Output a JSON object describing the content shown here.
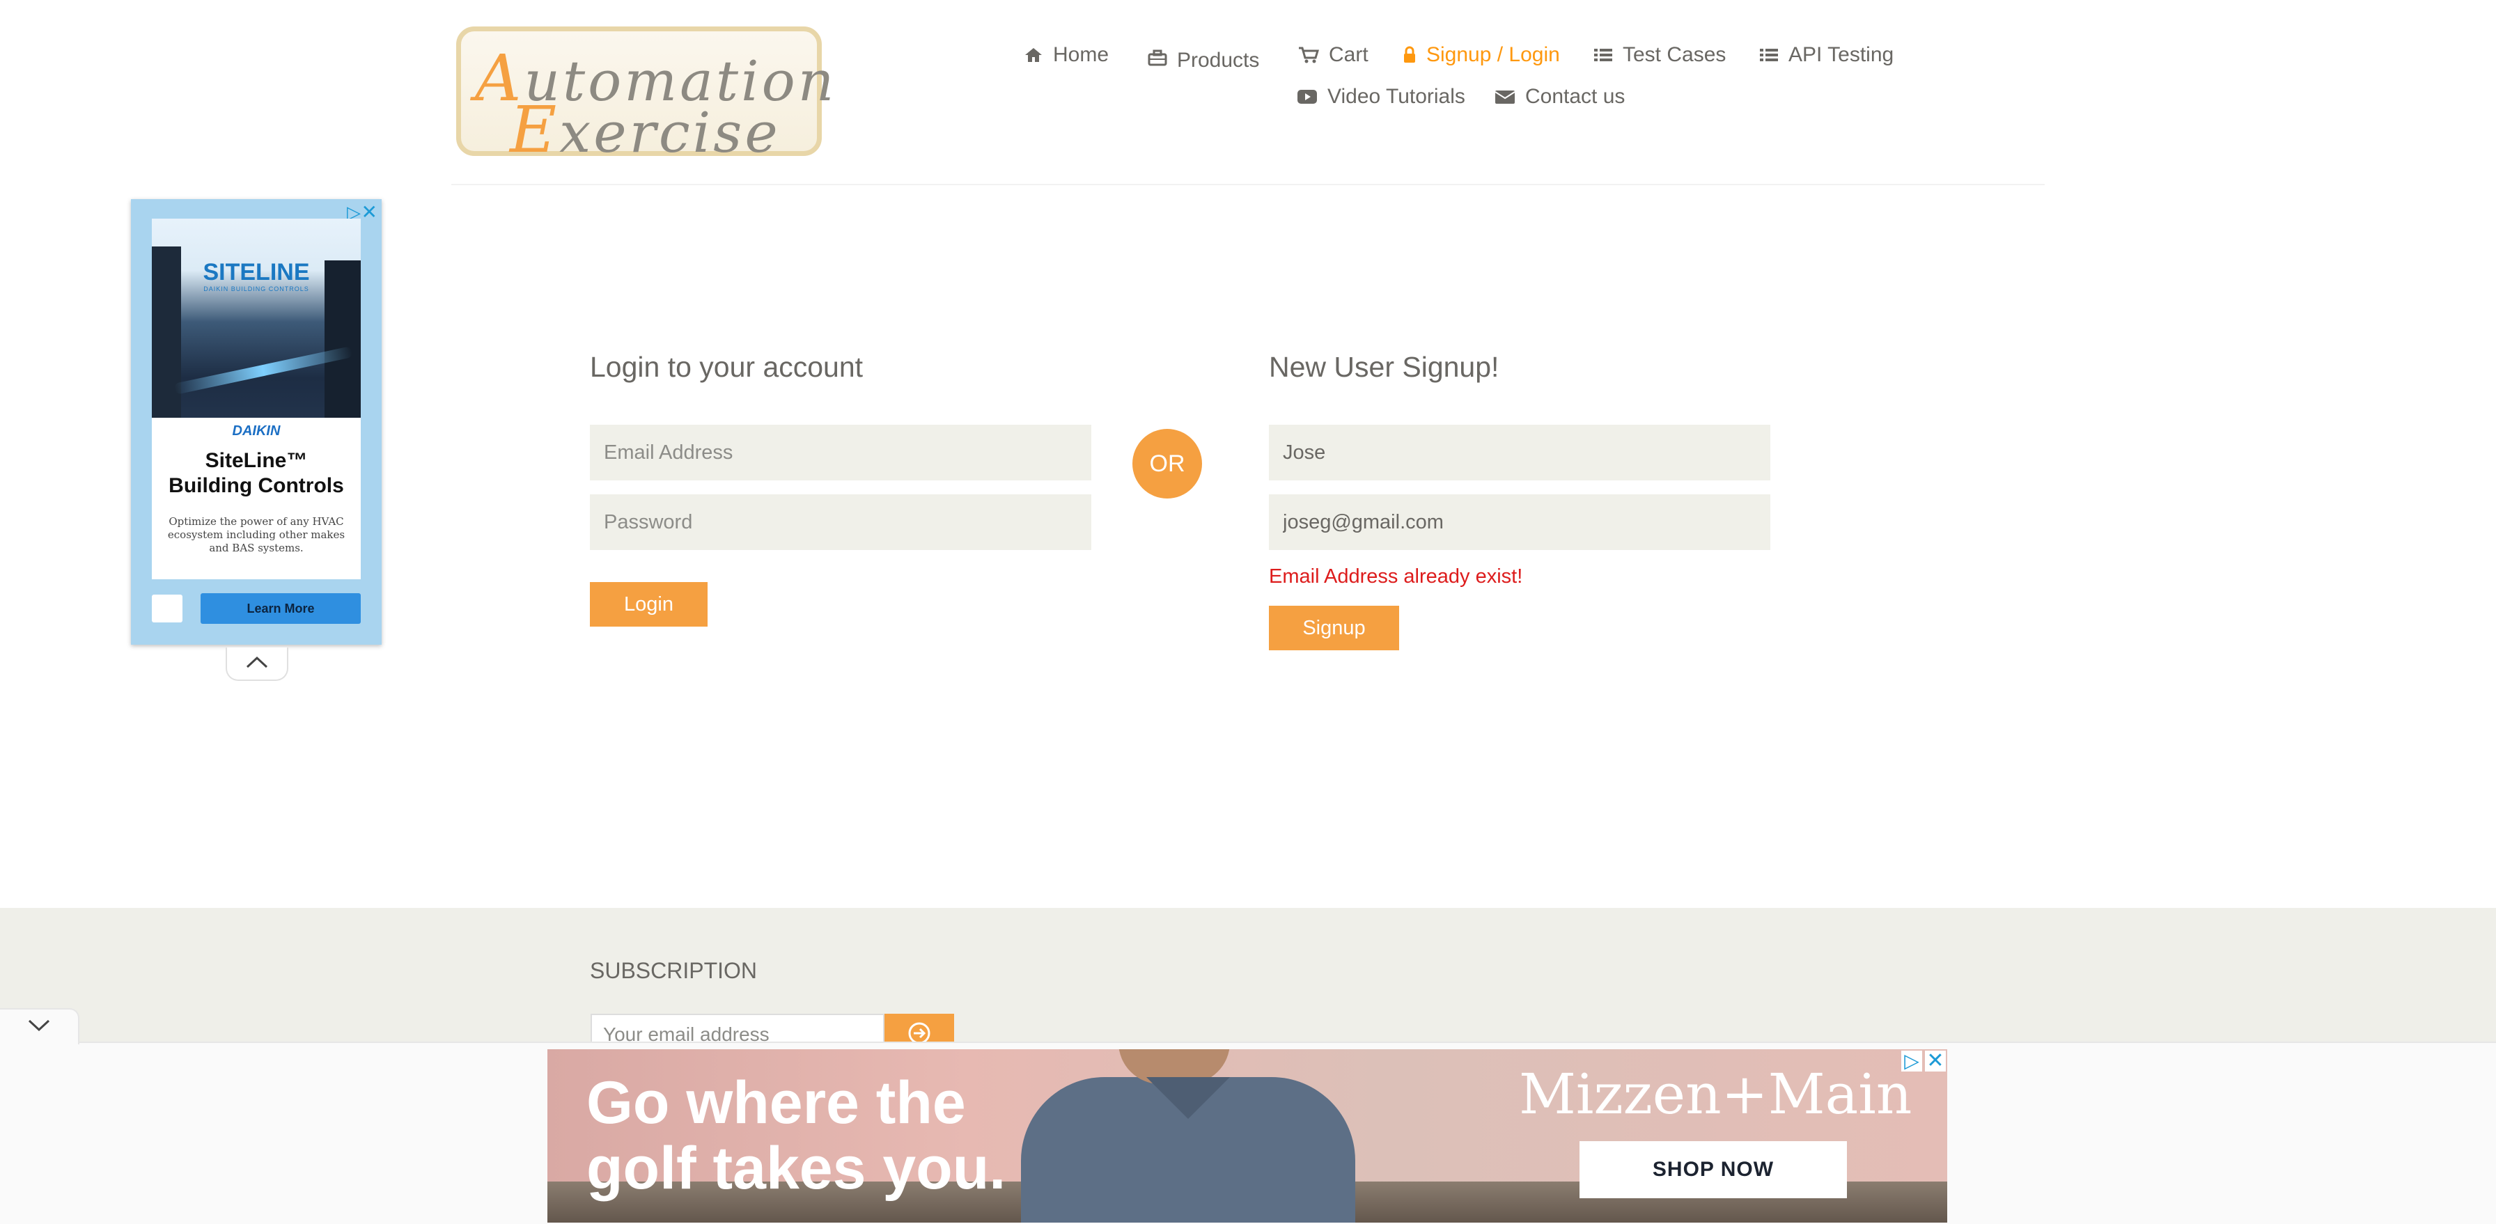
{
  "brand": {
    "logo_line1_cap": "A",
    "logo_line1_rest": "utomation",
    "logo_line2_cap": "E",
    "logo_line2_rest": "xercise"
  },
  "nav": {
    "items": [
      {
        "label": "Home",
        "icon": "home-icon"
      },
      {
        "label": "Products",
        "icon": "briefcase-icon"
      },
      {
        "label": "Cart",
        "icon": "cart-icon"
      },
      {
        "label": "Signup / Login",
        "icon": "lock-icon",
        "active": true
      },
      {
        "label": "Test Cases",
        "icon": "list-icon"
      },
      {
        "label": "API Testing",
        "icon": "list-icon"
      },
      {
        "label": "Video Tutorials",
        "icon": "youtube-icon"
      },
      {
        "label": "Contact us",
        "icon": "envelope-icon"
      }
    ],
    "active_color": "#fe980f"
  },
  "side_ad": {
    "brand": "SITELINE",
    "brand_sub": "DAIKIN BUILDING CONTROLS",
    "company": "DAIKIN",
    "product_line1": "SiteLine™",
    "product_line2": "Building Controls",
    "description": "Optimize the power of any HVAC ecosystem including other makes and BAS systems.",
    "cta": "Learn More"
  },
  "login": {
    "title": "Login to your account",
    "email_placeholder": "Email Address",
    "password_placeholder": "Password",
    "button": "Login"
  },
  "or_label": "OR",
  "signup": {
    "title": "New User Signup!",
    "name_value": "Jose",
    "email_value": "joseg@gmail.com",
    "error": "Email Address already exist!",
    "button": "Signup"
  },
  "footer": {
    "subscription_title": "SUBSCRIPTION",
    "email_placeholder": "Your email address"
  },
  "bottom_ad": {
    "headline_line1": "Go where the",
    "headline_line2": "golf takes you.",
    "brand": "Mizzen+Main",
    "cta": "SHOP NOW"
  },
  "colors": {
    "accent": "#f5a041",
    "field_bg": "#f0f0e9",
    "error": "#dd1c1c",
    "text": "#696763"
  }
}
